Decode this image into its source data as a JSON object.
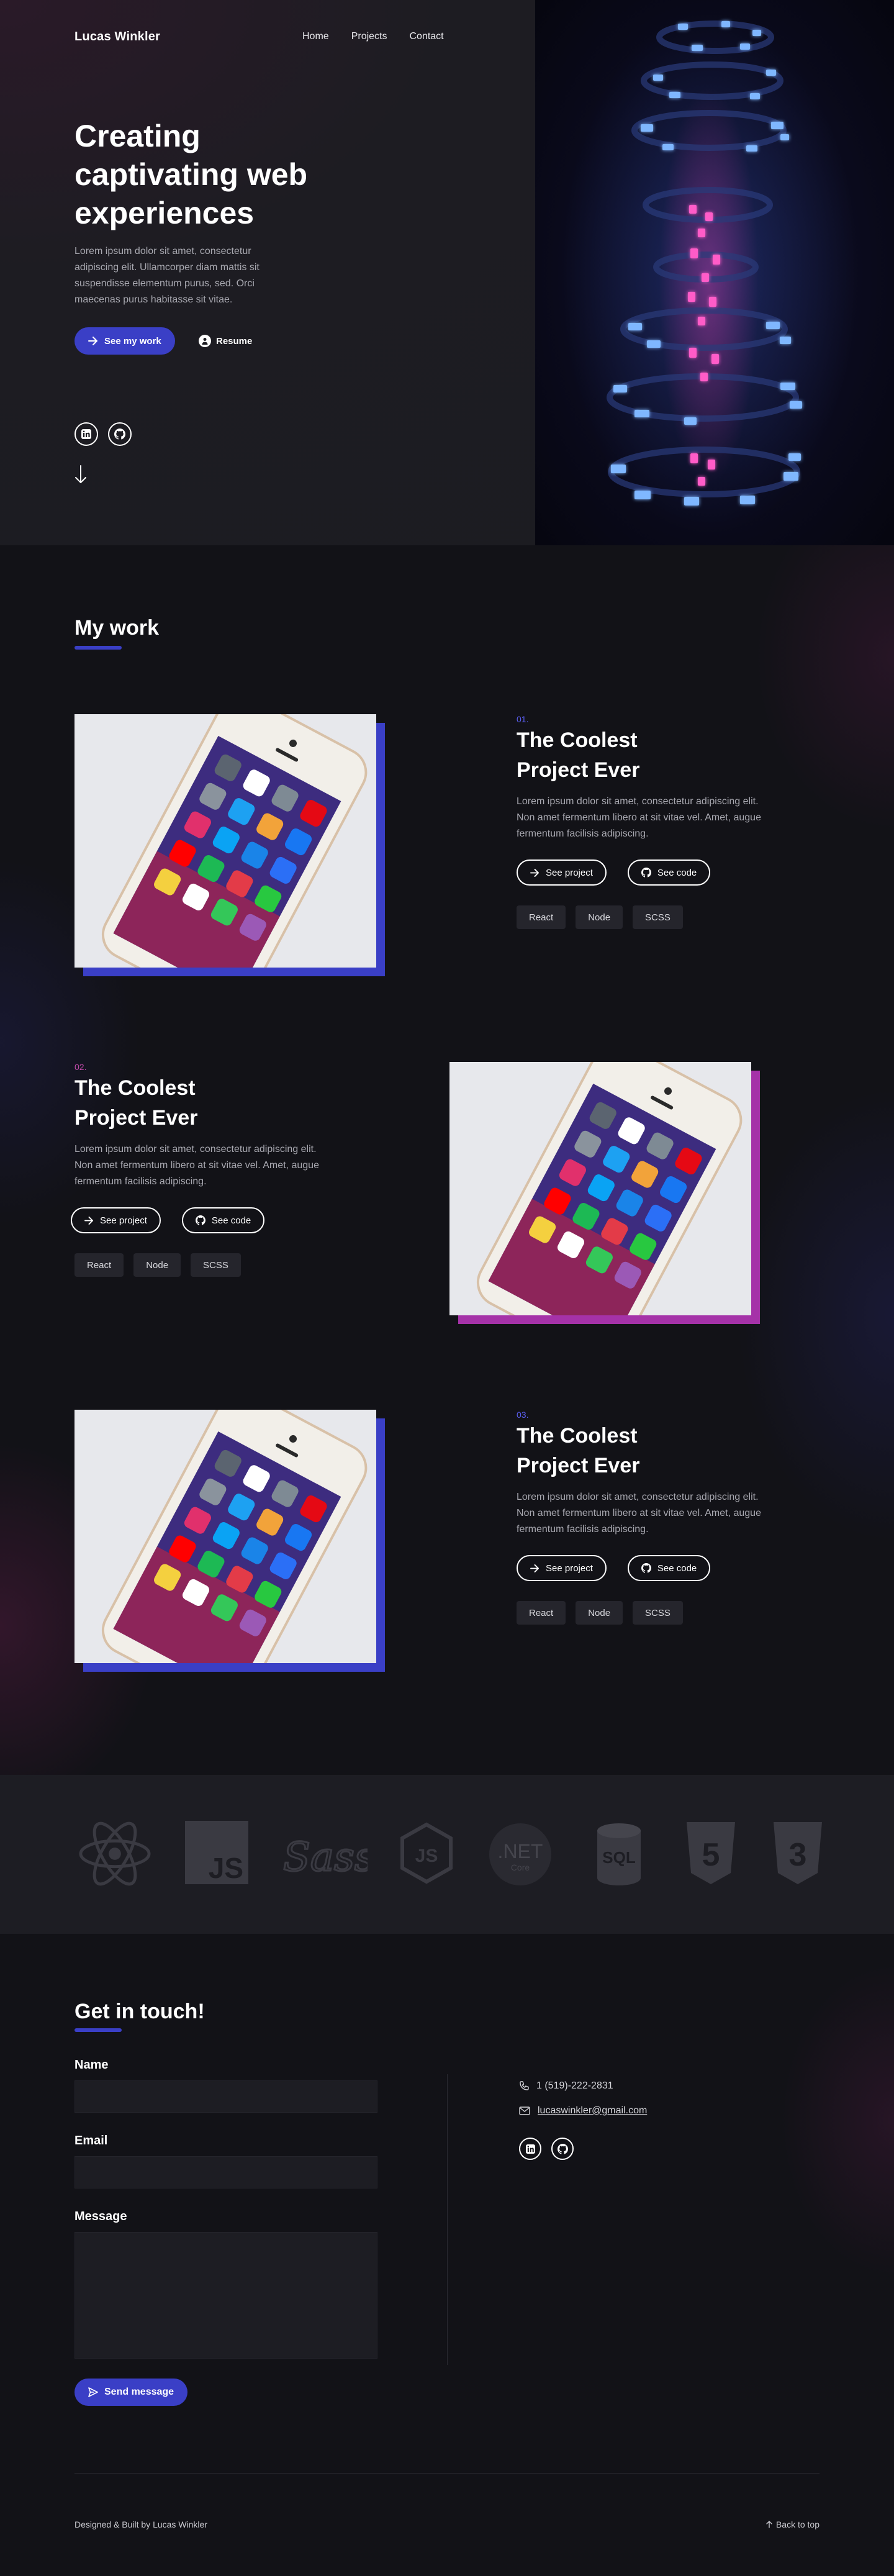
{
  "header": {
    "brand": "Lucas Winkler",
    "nav": [
      "Home",
      "Projects",
      "Contact"
    ]
  },
  "hero": {
    "title": "Creating captivating web experiences",
    "text": "Lorem ipsum dolor sit amet, consectetur adipiscing elit. Ullamcorper diam mattis sit suspendisse elementum purus, sed. Orci maecenas purus habitasse sit vitae.",
    "primary_button": "See my work",
    "resume_button": "Resume",
    "social_icons": [
      "linkedin-icon",
      "github-icon"
    ]
  },
  "work": {
    "title": "My work",
    "projects": [
      {
        "number": "01.",
        "title": "The Coolest Project Ever",
        "description": "Lorem ipsum dolor sit amet, consectetur adipiscing elit. Non amet fermentum libero at sit vitae vel. Amet, augue fermentum facilisis adipiscing.",
        "see_project": "See project",
        "see_code": "See code",
        "tags": [
          "React",
          "Node",
          "SCSS"
        ]
      },
      {
        "number": "02.",
        "title": "The Coolest Project Ever",
        "description": "Lorem ipsum dolor sit amet, consectetur adipiscing elit. Non amet fermentum libero at sit vitae vel. Amet, augue fermentum facilisis adipiscing.",
        "see_project": "See project",
        "see_code": "See code",
        "tags": [
          "React",
          "Node",
          "SCSS"
        ]
      },
      {
        "number": "03.",
        "title": "The Coolest Project Ever",
        "description": "Lorem ipsum dolor sit amet, consectetur adipiscing elit. Non amet fermentum libero at sit vitae vel. Amet, augue fermentum facilisis adipiscing.",
        "see_project": "See project",
        "see_code": "See code",
        "tags": [
          "React",
          "Node",
          "SCSS"
        ]
      }
    ]
  },
  "tech": {
    "logos": {
      "react": "react-logo-icon",
      "js": "JS",
      "sass": "Sass",
      "node": "JS",
      "dotnet": ".NET",
      "dotnet_sub": "Core",
      "sql": "SQL",
      "html5": "5",
      "css3": "3"
    }
  },
  "contact": {
    "title": "Get in touch!",
    "name_label": "Name",
    "email_label": "Email",
    "message_label": "Message",
    "send_button": "Send message",
    "phone": "1 (519)-222-2831",
    "email": "lucaswinkler@gmail.com"
  },
  "footer": {
    "credit": "Designed & Built by Lucas Winkler",
    "back_to_top": "Back to top"
  },
  "colors": {
    "accent": "#3a3fc6",
    "accent_pink": "#a532a8",
    "background": "#121217",
    "panel": "#1d1d23"
  }
}
